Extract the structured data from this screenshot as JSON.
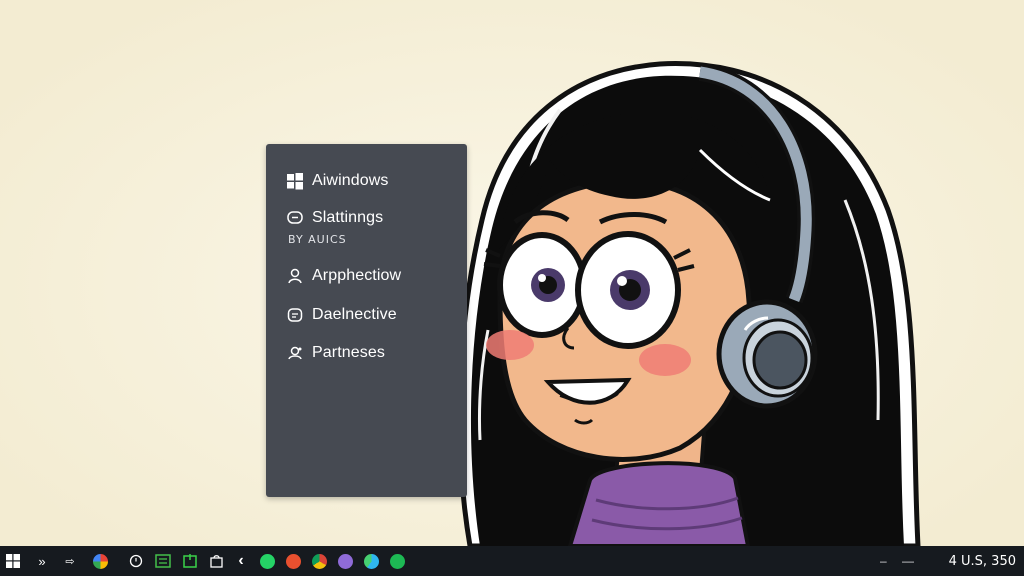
{
  "desktop": {
    "background_color": "#f8f3e0",
    "wallpaper": "cartoon girl with black hair, headphones and purple turtleneck"
  },
  "start_menu": {
    "background_color": "#464a52",
    "items": [
      {
        "label": "Aiwindows",
        "icon": "windows-logo-icon"
      },
      {
        "label": "Slattinngs",
        "icon": "chat-bubble-icon",
        "sublabel": "BY AUICS"
      },
      {
        "label": "Arpphectiow",
        "icon": "person-icon"
      },
      {
        "label": "Daelnective",
        "icon": "notes-icon"
      },
      {
        "label": "Partneses",
        "icon": "people-icon"
      }
    ]
  },
  "taskbar": {
    "background_color": "#161a1f",
    "icons": [
      "start-windows-icon",
      "chevron-double-right-icon",
      "back-forward-icon",
      "google-icon",
      "clock-icon",
      "calculator-icon",
      "green-app-icon",
      "bag-icon",
      "chevron-left-icon",
      "whatsapp-icon",
      "office-icon",
      "chrome-icon",
      "messenger-icon",
      "edge-icon",
      "spotify-icon"
    ],
    "tray": {
      "clock_text": "4 U.S, 350",
      "glyph_1": "–",
      "glyph_2": "—"
    }
  }
}
